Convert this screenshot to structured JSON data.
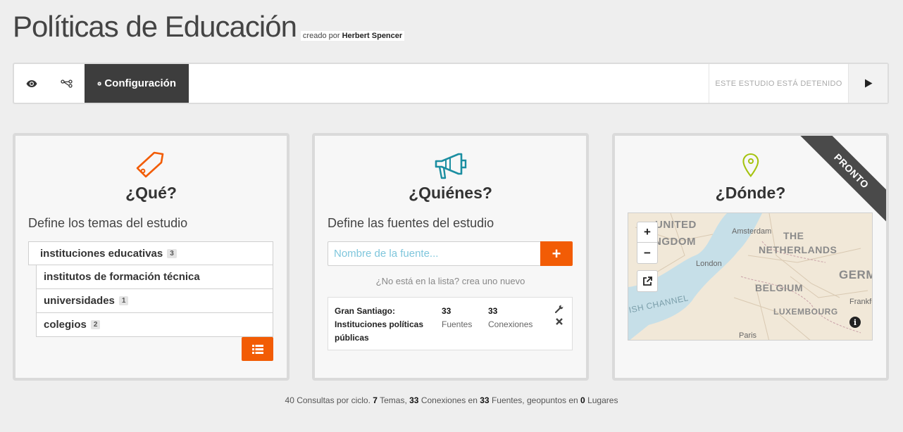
{
  "header": {
    "title": "Políticas de Educación",
    "byline_prefix": "creado por",
    "author": "Herbert Spencer"
  },
  "toolbar": {
    "view_icon": "eye-icon",
    "network_icon": "network-icon",
    "config_label": "Configuración",
    "status": "ESTE ESTUDIO ESTÁ DETENIDO",
    "play_icon": "play-icon"
  },
  "colors": {
    "accent_orange": "#f25c05",
    "dark": "#3d3d3d",
    "teal": "#1b8ea1",
    "lime": "#a5c30f"
  },
  "que": {
    "heading": "¿Qué?",
    "subtitle": "Define los temas del estudio",
    "topics": [
      {
        "label": "instituciones educativas",
        "count": "3",
        "level": 0
      },
      {
        "label": "institutos de formación técnica",
        "count": "",
        "level": 1
      },
      {
        "label": "universidades",
        "count": "1",
        "level": 1
      },
      {
        "label": "colegios",
        "count": "2",
        "level": 1
      }
    ]
  },
  "quienes": {
    "heading": "¿Quiénes?",
    "subtitle": "Define las fuentes del estudio",
    "input_placeholder": "Nombre de la fuente...",
    "add_label": "+",
    "create_link": "¿No está en la lista? crea uno nuevo",
    "source": {
      "name_line1": "Gran Santiago:",
      "name_line2": "Instituciones políticas",
      "name_line3": "públicas",
      "fuentes_value": "33",
      "fuentes_label": "Fuentes",
      "conexiones_value": "33",
      "conexiones_label": "Conexiones"
    }
  },
  "donde": {
    "heading": "¿Dónde?",
    "ribbon": "PRONTO",
    "zoom_in": "+",
    "zoom_out": "−",
    "map_labels": {
      "uk1": "UNITED",
      "uk2": "NGDOM",
      "nl1": "THE",
      "nl2": "NETHERLANDS",
      "be": "BELGIUM",
      "de": "GERM",
      "lu": "LUXEMBOURG",
      "channel": "ISH CHANNEL",
      "amsterdam": "Amsterdam",
      "london": "London",
      "paris": "Paris",
      "frankfurt": "Frankfu"
    }
  },
  "footer": {
    "p1": "40 Consultas por ciclo.",
    "temas_value": "7",
    "temas_label": "Temas,",
    "conexiones_value": "33",
    "conexiones_label": "Conexiones en",
    "fuentes_value": "33",
    "fuentes_label": "Fuentes, geopuntos en",
    "lugares_value": "0",
    "lugares_label": "Lugares"
  }
}
